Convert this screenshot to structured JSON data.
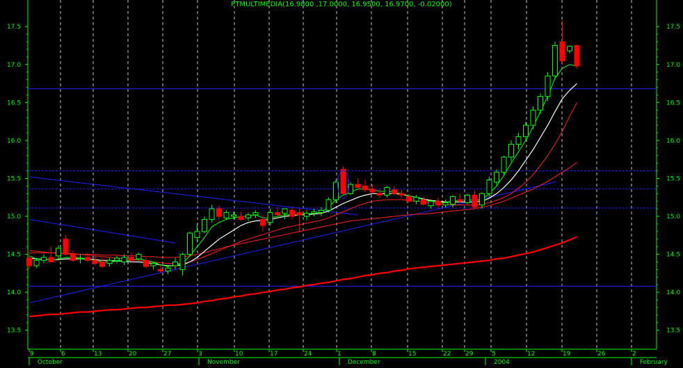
{
  "chart_data": {
    "type": "candlestick",
    "title": "PTMULTIMEDIA(16.9800 ,17.0000, 16.9500, 16.9700, -0.02000)",
    "ylim": [
      13.25,
      17.85
    ],
    "y_ticks": [
      "13.5",
      "14.0",
      "14.5",
      "15.0",
      "15.5",
      "16.0",
      "16.5",
      "17.0",
      "17.5"
    ],
    "x_day_labels": [
      "9",
      "6",
      "13",
      "20",
      "27",
      "3",
      "10",
      "17",
      "24",
      "1",
      "8",
      "15",
      "22",
      "29",
      "5",
      "12",
      "19",
      "26",
      "2"
    ],
    "x_month_labels": [
      "October",
      "November",
      "December",
      "2004",
      "February"
    ],
    "colors": {
      "background": "#000000",
      "axis": "#00ff00",
      "text": "#00ff00",
      "grid": "#c8c8c8",
      "up": "#00ff00",
      "down": "#ff0000",
      "ma_short": "#00ff00",
      "ma_mid": "#ffffff",
      "ma_long": "#ff2020",
      "ma_longest": "#ff0000",
      "trendline": "#2020ff"
    },
    "candles": [
      [
        14.45,
        14.52,
        14.3,
        14.35
      ],
      [
        14.35,
        14.45,
        14.32,
        14.42
      ],
      [
        14.42,
        14.5,
        14.38,
        14.46
      ],
      [
        14.46,
        14.6,
        14.4,
        14.4
      ],
      [
        14.48,
        14.62,
        14.44,
        14.58
      ],
      [
        14.7,
        14.75,
        14.48,
        14.5
      ],
      [
        14.5,
        14.55,
        14.4,
        14.42
      ],
      [
        14.45,
        14.5,
        14.38,
        14.45
      ],
      [
        14.46,
        14.52,
        14.4,
        14.42
      ],
      [
        14.42,
        14.48,
        14.36,
        14.38
      ],
      [
        14.4,
        14.46,
        14.32,
        14.34
      ],
      [
        14.38,
        14.45,
        14.34,
        14.42
      ],
      [
        14.42,
        14.48,
        14.38,
        14.45
      ],
      [
        14.4,
        14.5,
        14.36,
        14.46
      ],
      [
        14.46,
        14.52,
        14.4,
        14.42
      ],
      [
        14.44,
        14.52,
        14.42,
        14.5
      ],
      [
        14.42,
        14.46,
        14.32,
        14.34
      ],
      [
        14.35,
        14.4,
        14.3,
        14.38
      ],
      [
        14.3,
        14.35,
        14.25,
        14.28
      ],
      [
        14.28,
        14.34,
        14.24,
        14.32
      ],
      [
        14.35,
        14.45,
        14.3,
        14.4
      ],
      [
        14.3,
        14.52,
        14.22,
        14.5
      ],
      [
        14.5,
        14.8,
        14.48,
        14.78
      ],
      [
        14.72,
        14.9,
        14.66,
        14.8
      ],
      [
        14.8,
        15.0,
        14.78,
        14.96
      ],
      [
        14.96,
        15.15,
        14.92,
        15.1
      ],
      [
        15.1,
        15.15,
        14.95,
        15.0
      ],
      [
        14.98,
        15.08,
        14.95,
        15.05
      ],
      [
        15.0,
        15.06,
        14.96,
        15.02
      ],
      [
        15.0,
        15.06,
        14.94,
        14.96
      ],
      [
        14.98,
        15.05,
        14.94,
        15.02
      ],
      [
        15.02,
        15.08,
        14.98,
        15.05
      ],
      [
        14.96,
        15.02,
        14.8,
        14.88
      ],
      [
        14.92,
        15.1,
        14.88,
        15.05
      ],
      [
        15.05,
        15.12,
        15.0,
        15.02
      ],
      [
        15.04,
        15.1,
        14.96,
        15.1
      ],
      [
        15.08,
        15.12,
        14.96,
        15.0
      ],
      [
        15.05,
        15.1,
        14.8,
        15.02
      ],
      [
        15.0,
        15.08,
        14.95,
        15.04
      ],
      [
        15.04,
        15.1,
        15.0,
        15.06
      ],
      [
        15.05,
        15.12,
        15.0,
        15.08
      ],
      [
        15.08,
        15.25,
        15.05,
        15.22
      ],
      [
        15.22,
        15.48,
        15.18,
        15.45
      ],
      [
        15.62,
        15.66,
        15.28,
        15.3
      ],
      [
        15.3,
        15.45,
        15.28,
        15.42
      ],
      [
        15.42,
        15.5,
        15.34,
        15.38
      ],
      [
        15.4,
        15.48,
        15.32,
        15.35
      ],
      [
        15.36,
        15.42,
        15.3,
        15.32
      ],
      [
        15.3,
        15.36,
        15.24,
        15.28
      ],
      [
        15.28,
        15.4,
        15.25,
        15.38
      ],
      [
        15.35,
        15.4,
        15.28,
        15.3
      ],
      [
        15.3,
        15.35,
        15.25,
        15.28
      ],
      [
        15.26,
        15.3,
        15.18,
        15.2
      ],
      [
        15.2,
        15.28,
        15.16,
        15.25
      ],
      [
        15.22,
        15.26,
        15.14,
        15.16
      ],
      [
        15.14,
        15.22,
        15.1,
        15.2
      ],
      [
        15.2,
        15.25,
        15.1,
        15.15
      ],
      [
        15.15,
        15.22,
        15.12,
        15.18
      ],
      [
        15.16,
        15.28,
        15.12,
        15.26
      ],
      [
        15.22,
        15.3,
        15.18,
        15.2
      ],
      [
        15.18,
        15.3,
        15.16,
        15.28
      ],
      [
        15.28,
        15.34,
        15.1,
        15.12
      ],
      [
        15.15,
        15.32,
        15.1,
        15.3
      ],
      [
        15.3,
        15.52,
        15.26,
        15.48
      ],
      [
        15.45,
        15.62,
        15.4,
        15.58
      ],
      [
        15.58,
        15.8,
        15.54,
        15.78
      ],
      [
        15.78,
        16.0,
        15.72,
        15.95
      ],
      [
        15.95,
        16.1,
        15.88,
        16.05
      ],
      [
        16.05,
        16.25,
        16.0,
        16.2
      ],
      [
        16.2,
        16.45,
        16.15,
        16.4
      ],
      [
        16.4,
        16.62,
        16.35,
        16.58
      ],
      [
        16.58,
        16.9,
        16.52,
        16.85
      ],
      [
        16.85,
        17.3,
        16.8,
        17.25
      ],
      [
        17.3,
        17.58,
        17.0,
        17.05
      ],
      [
        17.18,
        17.25,
        17.15,
        17.24
      ],
      [
        17.25,
        17.26,
        16.95,
        16.98
      ]
    ],
    "ma_short": [
      14.48,
      14.44,
      14.44,
      14.42,
      14.44,
      14.46,
      14.46,
      14.45,
      14.44,
      14.42,
      14.4,
      14.4,
      14.41,
      14.42,
      14.42,
      14.44,
      14.42,
      14.4,
      14.36,
      14.34,
      14.36,
      14.38,
      14.48,
      14.6,
      14.72,
      14.86,
      14.92,
      14.96,
      14.98,
      15.0,
      15.0,
      15.02,
      14.98,
      14.98,
      15.0,
      15.02,
      15.02,
      15.02,
      15.03,
      15.04,
      15.06,
      15.12,
      15.22,
      15.28,
      15.32,
      15.36,
      15.36,
      15.35,
      15.33,
      15.33,
      15.32,
      15.3,
      15.27,
      15.25,
      15.22,
      15.2,
      15.19,
      15.18,
      15.2,
      15.21,
      15.22,
      15.21,
      15.22,
      15.3,
      15.4,
      15.54,
      15.7,
      15.85,
      16.0,
      16.18,
      16.38,
      16.58,
      16.82,
      16.95,
      17.0,
      16.98
    ],
    "ma_mid": [
      14.45,
      14.44,
      14.43,
      14.43,
      14.43,
      14.44,
      14.44,
      14.44,
      14.44,
      14.43,
      14.42,
      14.42,
      14.41,
      14.41,
      14.4,
      14.4,
      14.39,
      14.38,
      14.36,
      14.35,
      14.35,
      14.36,
      14.4,
      14.46,
      14.54,
      14.62,
      14.7,
      14.76,
      14.82,
      14.88,
      14.92,
      14.94,
      14.95,
      14.96,
      14.98,
      15.0,
      15.01,
      15.02,
      15.02,
      15.03,
      15.04,
      15.07,
      15.12,
      15.17,
      15.21,
      15.25,
      15.28,
      15.3,
      15.3,
      15.3,
      15.3,
      15.29,
      15.27,
      15.25,
      15.23,
      15.21,
      15.2,
      15.19,
      15.19,
      15.19,
      15.19,
      15.19,
      15.2,
      15.24,
      15.3,
      15.38,
      15.48,
      15.6,
      15.74,
      15.88,
      16.04,
      16.2,
      16.38,
      16.55,
      16.66,
      16.75
    ],
    "ma_long": [
      14.55,
      14.54,
      14.53,
      14.52,
      14.52,
      14.51,
      14.5,
      14.5,
      14.49,
      14.48,
      14.47,
      14.46,
      14.45,
      14.44,
      14.43,
      14.42,
      14.41,
      14.4,
      14.39,
      14.38,
      14.38,
      14.38,
      14.4,
      14.43,
      14.47,
      14.51,
      14.55,
      14.59,
      14.63,
      14.67,
      14.7,
      14.73,
      14.76,
      14.79,
      14.82,
      14.85,
      14.87,
      14.89,
      14.91,
      14.93,
      14.95,
      14.98,
      15.02,
      15.06,
      15.1,
      15.14,
      15.17,
      15.2,
      15.21,
      15.22,
      15.22,
      15.22,
      15.21,
      15.2,
      15.19,
      15.18,
      15.17,
      15.16,
      15.15,
      15.15,
      15.15,
      15.15,
      15.16,
      15.18,
      15.21,
      15.25,
      15.3,
      15.37,
      15.45,
      15.55,
      15.67,
      15.8,
      15.95,
      16.12,
      16.32,
      16.5
    ],
    "ma_longest": [
      14.52,
      14.52,
      14.52,
      14.52,
      14.51,
      14.51,
      14.51,
      14.5,
      14.5,
      14.5,
      14.49,
      14.49,
      14.49,
      14.48,
      14.48,
      14.48,
      14.47,
      14.47,
      14.46,
      14.46,
      14.46,
      14.47,
      14.48,
      14.5,
      14.52,
      14.55,
      14.57,
      14.6,
      14.62,
      14.64,
      14.66,
      14.68,
      14.7,
      14.72,
      14.74,
      14.76,
      14.78,
      14.8,
      14.82,
      14.84,
      14.86,
      14.88,
      14.9,
      14.92,
      14.94,
      14.95,
      14.96,
      14.97,
      14.98,
      14.99,
      15.0,
      15.01,
      15.02,
      15.03,
      15.03,
      15.04,
      15.05,
      15.06,
      15.07,
      15.08,
      15.09,
      15.1,
      15.12,
      15.14,
      15.17,
      15.2,
      15.24,
      15.28,
      15.32,
      15.36,
      15.41,
      15.46,
      15.52,
      15.58,
      15.64,
      15.71
    ],
    "ma_200": [
      13.68,
      13.69,
      13.7,
      13.71,
      13.71,
      13.72,
      13.73,
      13.74,
      13.74,
      13.75,
      13.76,
      13.77,
      13.77,
      13.78,
      13.79,
      13.8,
      13.8,
      13.81,
      13.82,
      13.83,
      13.83,
      13.84,
      13.85,
      13.86,
      13.88,
      13.89,
      13.91,
      13.92,
      13.94,
      13.95,
      13.97,
      13.98,
      14.0,
      14.01,
      14.03,
      14.04,
      14.06,
      14.07,
      14.09,
      14.1,
      14.12,
      14.13,
      14.15,
      14.17,
      14.18,
      14.2,
      14.22,
      14.23,
      14.25,
      14.26,
      14.28,
      14.29,
      14.31,
      14.32,
      14.33,
      14.34,
      14.35,
      14.36,
      14.37,
      14.38,
      14.39,
      14.4,
      14.41,
      14.42,
      14.44,
      14.45,
      14.47,
      14.49,
      14.51,
      14.53,
      14.56,
      14.59,
      14.62,
      14.65,
      14.69,
      14.73
    ],
    "h_lines": [
      {
        "y": 16.68,
        "style": "solid"
      },
      {
        "y": 15.6,
        "style": "dashed"
      },
      {
        "y": 15.36,
        "style": "dashed"
      },
      {
        "y": 15.11,
        "style": "dashed"
      },
      {
        "y": 14.08,
        "style": "solid"
      }
    ],
    "trendlines": [
      {
        "from": [
          0,
          15.52
        ],
        "to": [
          45,
          15.02
        ]
      },
      {
        "from": [
          0,
          14.96
        ],
        "to": [
          20,
          14.65
        ]
      },
      {
        "from": [
          0,
          13.86
        ],
        "to": [
          72,
          15.45
        ]
      }
    ]
  }
}
